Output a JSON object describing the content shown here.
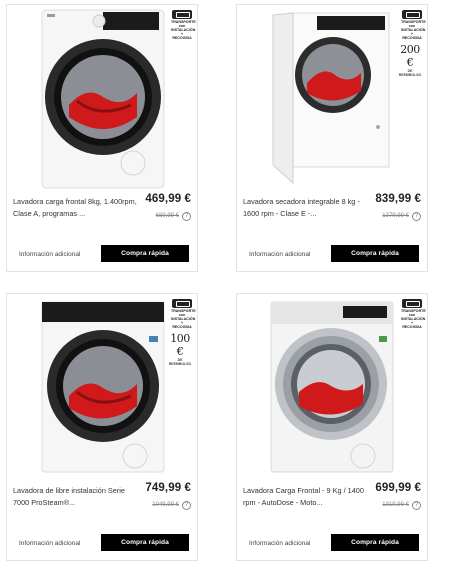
{
  "products": [
    {
      "title": "Lavadora carga frontal 8kg, 1.400rpm, Clase A, programas ...",
      "price": "469,99 €",
      "old_price": "689,99 €",
      "badge": "TRANSPORTE con INSTALACIÓN + RECOGIDA",
      "promo_amount": "",
      "promo_label": "",
      "more_info_label": "Información adicional",
      "quick_buy_label": "Compra rápida",
      "image_icon": "front-load-washer-white"
    },
    {
      "title": "Lavadora secadora integrable 8 kg - 1600 rpm - Clase E -...",
      "price": "839,99 €",
      "old_price": "1379,99 €",
      "badge": "TRANSPORTE con INSTALACIÓN + RECOGIDA",
      "promo_amount": "200 €",
      "promo_label": "DE REEMBOLSO",
      "more_info_label": "Información adicional",
      "quick_buy_label": "Compra rápida",
      "image_icon": "integrated-washer-dryer"
    },
    {
      "title": "Lavadora de libre instalación Serie 7000 ProSteam®...",
      "price": "749,99 €",
      "old_price": "1049,99 €",
      "badge": "TRANSPORTE con INSTALACIÓN + RECOGIDA",
      "promo_amount": "100 €",
      "promo_label": "DE REEMBOLSO",
      "more_info_label": "Información adicional",
      "quick_buy_label": "Compra rápida",
      "image_icon": "front-load-washer-white"
    },
    {
      "title": "Lavadora Carga Frontal - 9 Kg / 1400 rpm - AutoDose - Moto...",
      "price": "699,99 €",
      "old_price": "1319,99 €",
      "badge": "TRANSPORTE con INSTALACIÓN + RECOGIDA",
      "promo_amount": "",
      "promo_label": "",
      "more_info_label": "Información adicional",
      "quick_buy_label": "Compra rápida",
      "image_icon": "front-load-washer-silver"
    }
  ],
  "colors": {
    "button_bg": "#000000",
    "button_text": "#ffffff",
    "drum_cloth": "#d0191b",
    "door_ring_dark": "#2a2a2a",
    "door_ring_silver": "#9aa0a6"
  }
}
